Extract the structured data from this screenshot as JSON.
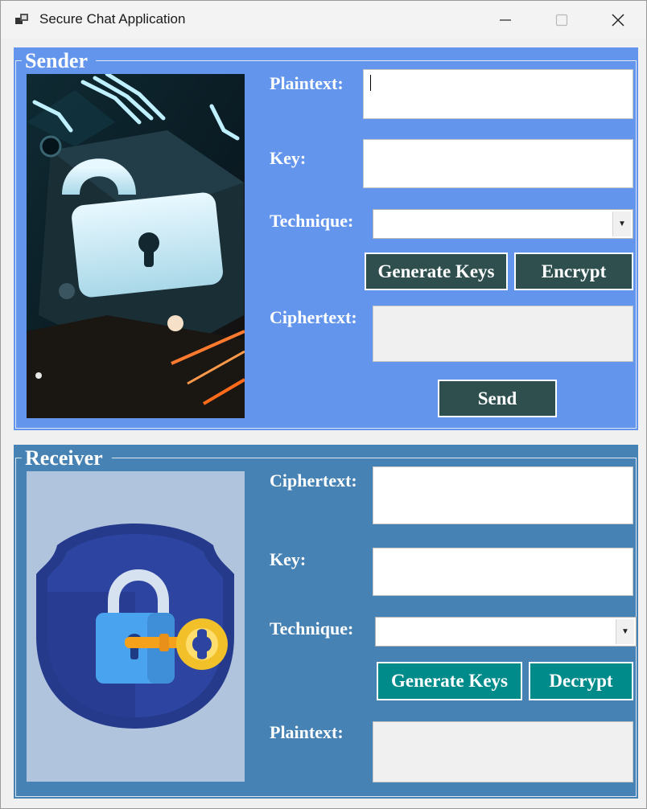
{
  "window": {
    "title": "Secure Chat Application",
    "icons": [
      "app-icon",
      "minimize-icon",
      "maximize-icon",
      "close-icon"
    ]
  },
  "sender": {
    "legend": "Sender",
    "plaintext_label": "Plaintext:",
    "plaintext_value": "",
    "key_label": "Key:",
    "key_value": "",
    "technique_label": "Technique:",
    "technique_value": "",
    "generate_keys_label": "Generate Keys",
    "encrypt_label": "Encrypt",
    "ciphertext_label": "Ciphertext:",
    "ciphertext_value": "",
    "send_label": "Send",
    "image_icon": "circuit-padlock-image"
  },
  "receiver": {
    "legend": "Receiver",
    "ciphertext_label": "Ciphertext:",
    "ciphertext_value": "",
    "key_label": "Key:",
    "key_value": "",
    "technique_label": "Technique:",
    "technique_value": "",
    "generate_keys_label": "Generate Keys",
    "decrypt_label": "Decrypt",
    "plaintext_label": "Plaintext:",
    "plaintext_value": "",
    "image_icon": "shield-padlock-key-image"
  },
  "colors": {
    "sender_bg": "#6495ed",
    "receiver_bg": "#4682b4",
    "dark_button": "#2f4f4f",
    "teal_button": "#008b8b"
  }
}
